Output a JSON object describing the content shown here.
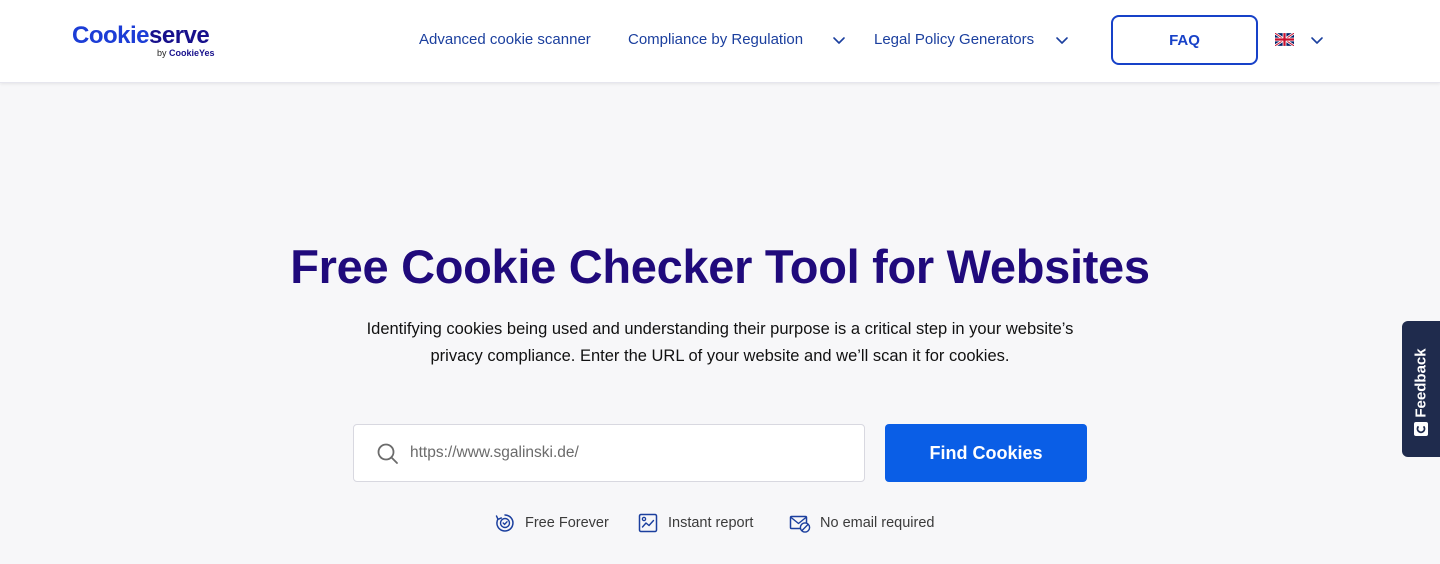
{
  "brand": {
    "name_part1": "Cookie",
    "name_part2": "serve",
    "tagline_prefix": "by",
    "tagline_brand": "CookieYes"
  },
  "nav": {
    "items": [
      {
        "label": "Advanced cookie scanner",
        "has_dropdown": false
      },
      {
        "label": "Compliance by Regulation",
        "has_dropdown": true
      },
      {
        "label": "Legal Policy Generators",
        "has_dropdown": true
      }
    ],
    "faq_label": "FAQ",
    "language_icon": "uk-flag-icon"
  },
  "hero": {
    "title": "Free Cookie Checker Tool for Websites",
    "description": "Identifying cookies being used and understanding their purpose is a critical step in your website’s privacy compliance. Enter the URL of your website and we’ll scan it for cookies."
  },
  "search": {
    "placeholder": "https://www.sgalinski.de/",
    "value": "",
    "button_label": "Find Cookies"
  },
  "features": [
    {
      "label": "Free Forever",
      "icon": "free-forever-icon"
    },
    {
      "label": "Instant report",
      "icon": "instant-report-icon"
    },
    {
      "label": "No email required",
      "icon": "no-email-icon"
    }
  ],
  "feedback": {
    "label": "Feedback"
  },
  "colors": {
    "brand_blue": "#1c3dd6",
    "title_navy": "#200a7c",
    "nav_link": "#1b3f9e",
    "primary_button": "#0a5ee6",
    "feedback_bg": "#1f2b4d",
    "page_bg": "#f7f7f9"
  }
}
